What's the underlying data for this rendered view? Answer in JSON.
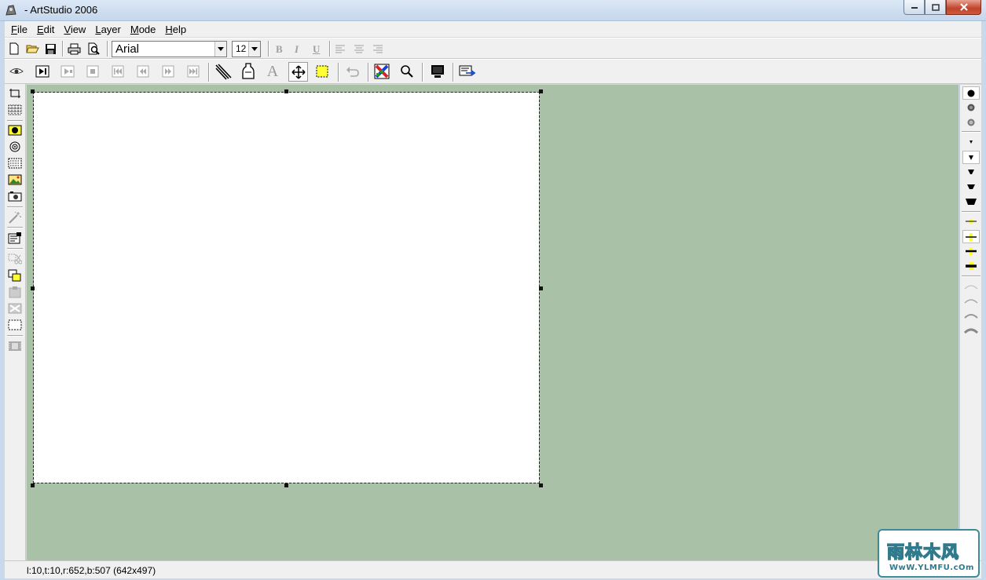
{
  "window": {
    "title": "- ArtStudio 2006"
  },
  "menu": {
    "items": [
      "File",
      "Edit",
      "View",
      "Layer",
      "Mode",
      "Help"
    ],
    "mnemonics": [
      "F",
      "E",
      "V",
      "L",
      "M",
      "H"
    ]
  },
  "font_toolbar": {
    "font_name": "Arial",
    "font_size": "12",
    "bold_label": "B",
    "italic_label": "I",
    "underline_label": "U"
  },
  "tools_toolbar": {
    "text_tool_label": "A",
    "active_tool": "move-icon"
  },
  "status": {
    "selection_info": "l:10,t:10,r:652,b:507 (642x497)"
  },
  "watermark": {
    "chinese_text": "雨林木风",
    "english_text": "WwW.YLMFU.cOm"
  },
  "colors": {
    "workspace_bg": "#a9c1a6",
    "canvas_bg": "#ffffff",
    "panel_bg": "#f0f0f0"
  }
}
